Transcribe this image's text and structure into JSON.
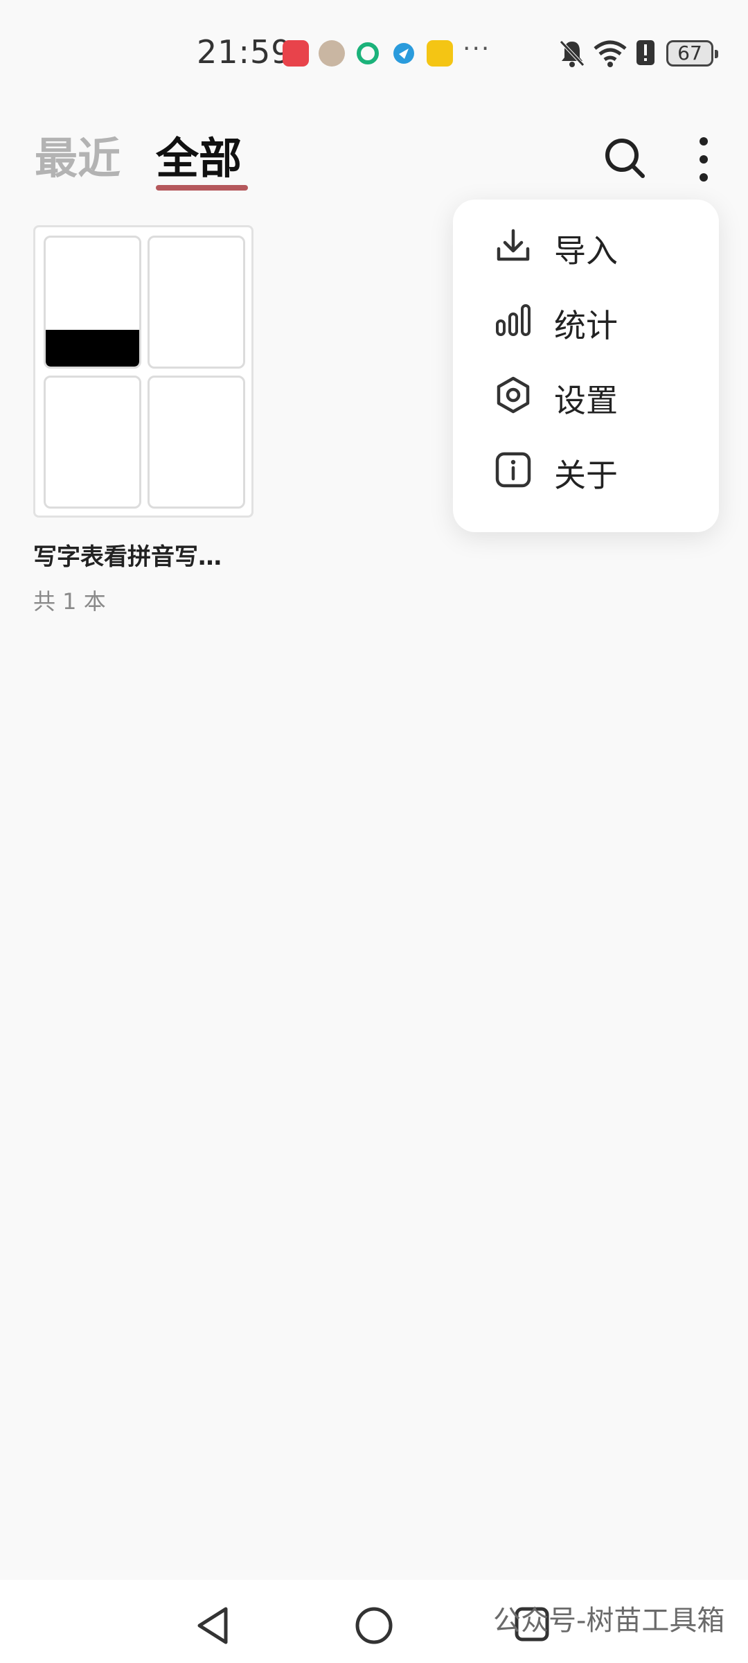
{
  "status_bar": {
    "time": "21:59",
    "more": "···",
    "battery": "67",
    "notification_icons": [
      "huawei-appgallery-icon",
      "photo-avatar-icon",
      "green-app-icon",
      "blue-app-icon",
      "yellow-app-icon"
    ],
    "system_icons": [
      "bell-muted-icon",
      "wifi-icon",
      "alert-icon",
      "battery-icon"
    ]
  },
  "header": {
    "tabs": [
      {
        "label": "最近",
        "active": false
      },
      {
        "label": "全部",
        "active": true
      }
    ],
    "accent_color": "#b5585c"
  },
  "books": [
    {
      "title": "写字表看拼音写…",
      "count_label": "共 1 本"
    }
  ],
  "menu": {
    "items": [
      {
        "label": "导入",
        "icon": "download-icon"
      },
      {
        "label": "统计",
        "icon": "bar-chart-icon"
      },
      {
        "label": "设置",
        "icon": "hexagon-settings-icon"
      },
      {
        "label": "关于",
        "icon": "info-icon"
      }
    ]
  },
  "navbar": {
    "buttons": [
      "back-icon",
      "home-icon",
      "recents-icon"
    ],
    "watermark": "公众号-树苗工具箱"
  }
}
